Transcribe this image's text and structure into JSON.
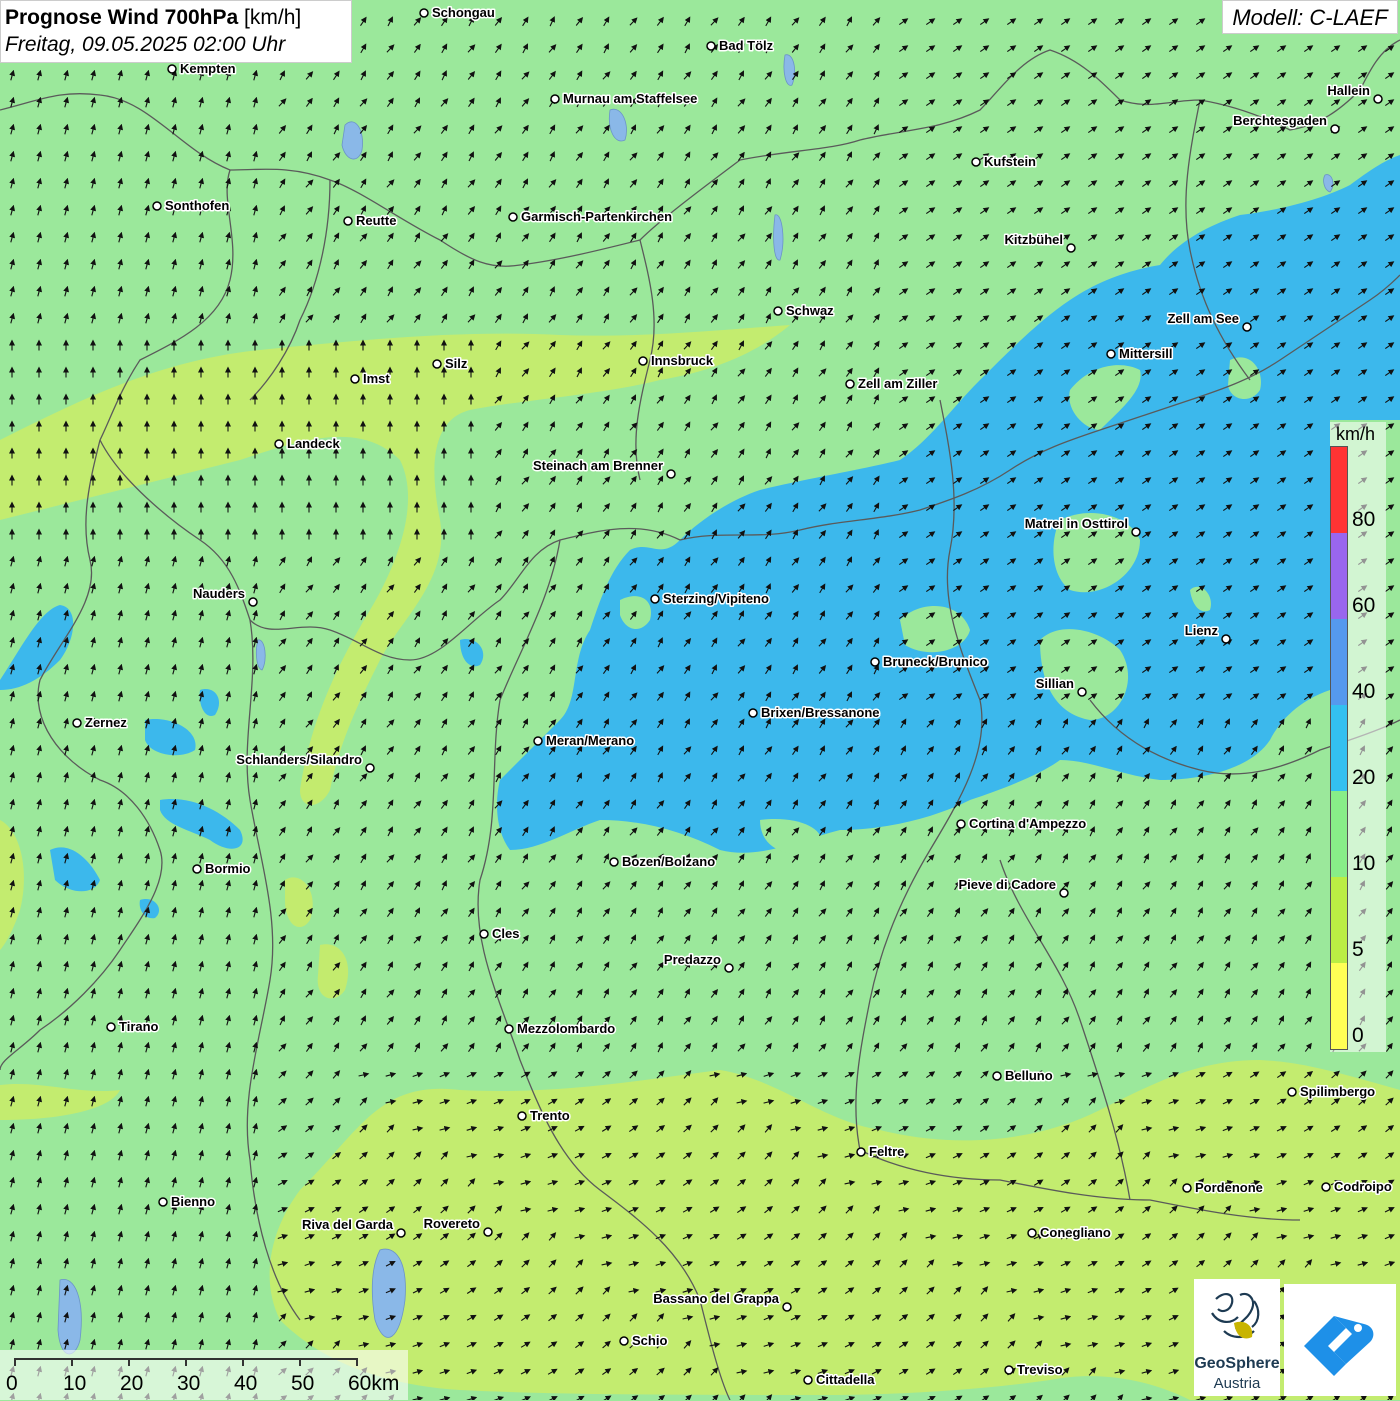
{
  "title": {
    "bold": "Prognose Wind 700hPa",
    "unit": " [km/h]",
    "datetime": "Freitag, 09.05.2025 02:00 Uhr"
  },
  "model": "Modell: C-LAEF",
  "legend": {
    "unit": "km/h",
    "labels": [
      "80",
      "60",
      "40",
      "20",
      "10",
      "5",
      "0"
    ],
    "colors": [
      "#ff3333",
      "#9966ee",
      "#5599ee",
      "#33c0f0",
      "#88ee88",
      "#bbee44",
      "#ffff55"
    ]
  },
  "scale_bar": {
    "labels": [
      "0",
      "10",
      "20",
      "30",
      "40",
      "50",
      "60km"
    ]
  },
  "logos": {
    "geosphere_line1": "GeoSphere",
    "geosphere_line2": "Austria"
  },
  "cities": [
    {
      "name": "Schongau"
    },
    {
      "name": "Bad Tölz"
    },
    {
      "name": "Kempten"
    },
    {
      "name": "Murnau am Staffelsee"
    },
    {
      "name": "Hallein"
    },
    {
      "name": "Berchtesgaden"
    },
    {
      "name": "Kufstein"
    },
    {
      "name": "Sonthofen"
    },
    {
      "name": "Reutte"
    },
    {
      "name": "Garmisch-Partenkirchen"
    },
    {
      "name": "Kitzbühel"
    },
    {
      "name": "Schwaz"
    },
    {
      "name": "Zell am See"
    },
    {
      "name": "Mittersill"
    },
    {
      "name": "Imst"
    },
    {
      "name": "Silz"
    },
    {
      "name": "Innsbruck"
    },
    {
      "name": "Zell am Ziller"
    },
    {
      "name": "Landeck"
    },
    {
      "name": "Steinach am Brenner"
    },
    {
      "name": "Matrei in Osttirol"
    },
    {
      "name": "Nauders"
    },
    {
      "name": "Sterzing/Vipiteno"
    },
    {
      "name": "Lienz"
    },
    {
      "name": "Bruneck/Brunico"
    },
    {
      "name": "Sillian"
    },
    {
      "name": "Zernez"
    },
    {
      "name": "Brixen/Bressanone"
    },
    {
      "name": "Meran/Merano"
    },
    {
      "name": "Schlanders/Silandro"
    },
    {
      "name": "Cortina d'Ampezzo"
    },
    {
      "name": "Bozen/Bolzano"
    },
    {
      "name": "Bormio"
    },
    {
      "name": "Pieve di Cadore"
    },
    {
      "name": "Cles"
    },
    {
      "name": "Predazzo"
    },
    {
      "name": "Tirano"
    },
    {
      "name": "Mezzolombardo"
    },
    {
      "name": "Belluno"
    },
    {
      "name": "Spilimbergo"
    },
    {
      "name": "Trento"
    },
    {
      "name": "Feltre"
    },
    {
      "name": "Pordenone"
    },
    {
      "name": "Codroipo"
    },
    {
      "name": "Bienno"
    },
    {
      "name": "Riva del Garda"
    },
    {
      "name": "Rovereto"
    },
    {
      "name": "Conegliano"
    },
    {
      "name": "Bassano del Grappa"
    },
    {
      "name": "Schio"
    },
    {
      "name": "Treviso"
    },
    {
      "name": "Cittadella"
    }
  ]
}
